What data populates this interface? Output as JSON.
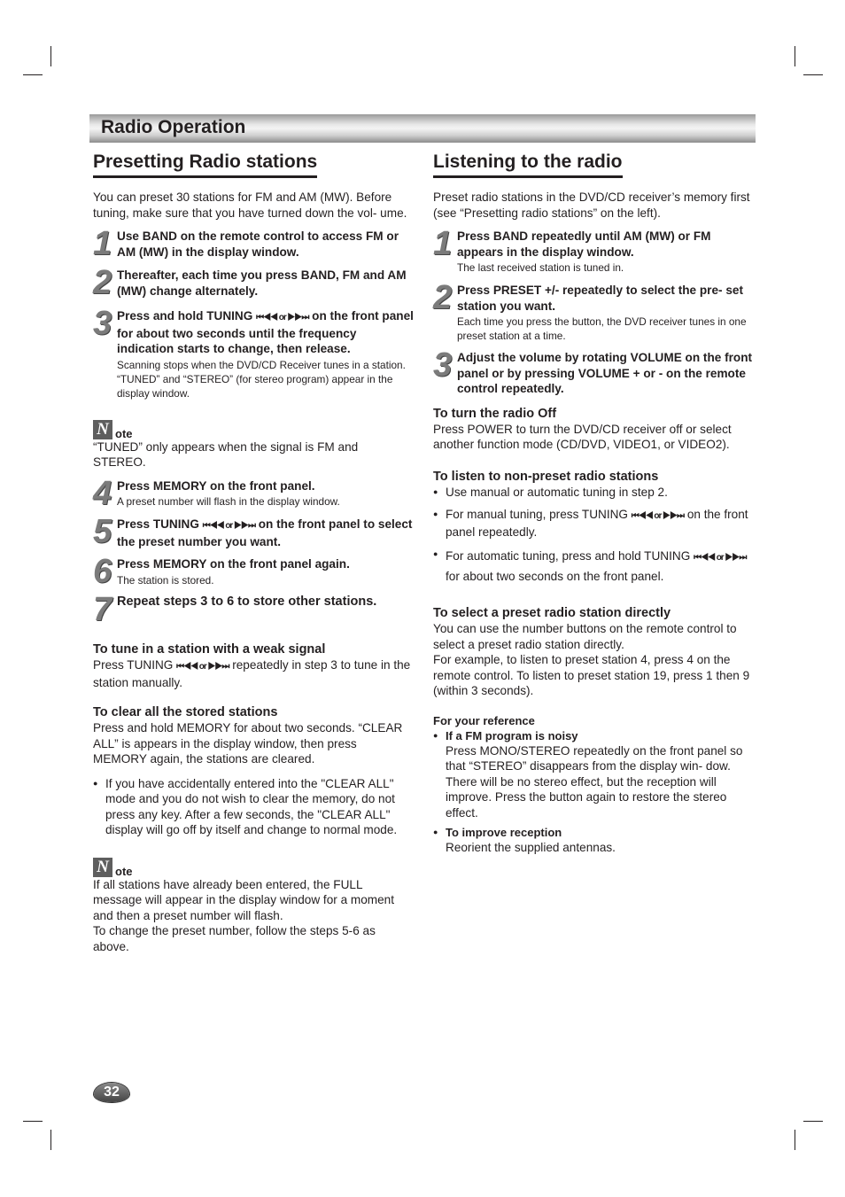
{
  "banner": {
    "title": "Radio Operation"
  },
  "left": {
    "heading": "Presetting Radio stations",
    "intro": "You can preset 30 stations for FM and AM (MW). Before tuning, make sure that you have turned down the vol- ume.",
    "steps": [
      {
        "num": "1",
        "bold": "Use BAND on the remote control to access FM or AM (MW) in the display window.",
        "small": ""
      },
      {
        "num": "2",
        "bold": "Thereafter, each time you press BAND, FM and AM (MW) change alternately.",
        "small": ""
      },
      {
        "num": "3",
        "bold_pre": "Press and hold TUNING",
        "bold_icons": "⏮◀◀ or ▶▶⏭",
        "bold_post": "on the front panel for about two seconds until the frequency indication starts to change, then release.",
        "small": "Scanning stops when the DVD/CD Receiver tunes in a station. “TUNED” and “STEREO” (for stereo program) appear in the display window."
      },
      {
        "num": "4",
        "bold": "Press MEMORY on the front panel.",
        "small": "A preset number will flash in the display window."
      },
      {
        "num": "5",
        "bold_pre": "Press TUNING",
        "bold_icons": "⏮◀◀ or ▶▶⏭",
        "bold_post": "on the front panel to select the preset number you want.",
        "small": ""
      },
      {
        "num": "6",
        "bold": "Press MEMORY on the front panel again.",
        "small": "The station is stored."
      },
      {
        "num": "7",
        "bold": "Repeat steps 3 to 6 to store other stations.",
        "small": ""
      }
    ],
    "note1": {
      "icon_letter": "N",
      "label": "ote",
      "text": "“TUNED” only appears when the signal is FM and STEREO."
    },
    "weak_signal": {
      "heading": "To tune in a station with a weak signal",
      "pre": "Press TUNING",
      "icons": "⏮◀◀ or ▶▶⏭",
      "post": "repeatedly in step 3 to tune in the station manually."
    },
    "clear": {
      "heading": "To clear all the stored stations",
      "text": "Press and hold MEMORY for about two seconds. “CLEAR ALL” is appears in the display window, then press MEMORY again, the stations are cleared.",
      "bullet": "If you have accidentally entered into the \"CLEAR ALL\" mode and you do not wish to clear the memory, do not press any key. After a few seconds, the \"CLEAR ALL\" display will go off by itself and change to normal mode."
    },
    "note2": {
      "icon_letter": "N",
      "label": "ote",
      "text1": "If all stations have already been entered, the FULL message will appear in the display window for a moment and then a preset number will flash.",
      "text2": "To change the preset number, follow the steps 5-6 as above."
    }
  },
  "right": {
    "heading": "Listening to the radio",
    "intro": "Preset radio stations in the DVD/CD receiver’s memory first (see “Presetting radio stations” on the left).",
    "steps": [
      {
        "num": "1",
        "bold": "Press BAND repeatedly until AM (MW) or FM appears in the display window.",
        "small": "The last received station is tuned in."
      },
      {
        "num": "2",
        "bold": "Press PRESET +/- repeatedly to select the pre- set station you want.",
        "small": "Each time you press the button, the DVD receiver tunes in one preset station at a time."
      },
      {
        "num": "3",
        "bold": "Adjust the volume by rotating VOLUME on the front panel or by pressing VOLUME + or - on the remote control repeatedly.",
        "small": ""
      }
    ],
    "radio_off": {
      "heading": "To turn the radio Off",
      "text": "Press POWER to turn the DVD/CD receiver off or select another function mode (CD/DVD, VIDEO1, or VIDEO2)."
    },
    "non_preset": {
      "heading": "To listen to non-preset radio stations",
      "b1": "Use manual or automatic tuning in step 2.",
      "b2_pre": "For manual tuning, press TUNING",
      "b2_icons": "⏮◀◀ or ▶▶⏭",
      "b2_post": "on the front panel repeatedly.",
      "b3_pre": "For automatic tuning, press and hold TUNING",
      "b3_icons": "⏮◀◀ or ▶▶⏭",
      "b3_post": "for about two seconds on the front panel."
    },
    "direct": {
      "heading": "To select a preset radio station directly",
      "text1": "You can use the number buttons on the remote control to select a preset radio station directly.",
      "text2": "For example, to listen to preset station 4, press 4 on the remote control. To listen to preset station 19, press 1 then 9 (within 3 seconds)."
    },
    "reference": {
      "heading": "For your reference",
      "b1_title": "If a FM program is noisy",
      "b1_text": "Press MONO/STEREO repeatedly on the front panel so that “STEREO” disappears from the display win- dow. There will be no stereo effect, but the reception will improve. Press the button again to restore the stereo effect.",
      "b2_title": "To improve reception",
      "b2_text": "Reorient the supplied antennas."
    }
  },
  "footer": {
    "page_number": "32"
  }
}
